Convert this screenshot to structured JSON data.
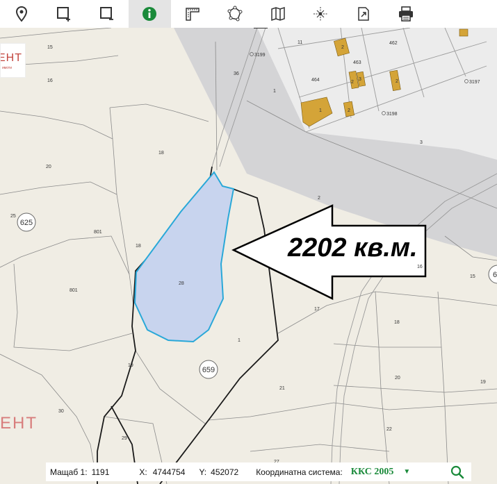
{
  "toolbar": {
    "tools": [
      {
        "name": "location-pin-icon",
        "active": false
      },
      {
        "name": "select-add-icon",
        "active": false
      },
      {
        "name": "select-remove-icon",
        "active": false
      },
      {
        "name": "info-icon",
        "active": true
      },
      {
        "name": "measure-icon",
        "active": false
      },
      {
        "name": "polygon-icon",
        "active": false
      },
      {
        "name": "map-icon",
        "active": false
      },
      {
        "name": "coordinates-icon",
        "active": false
      },
      {
        "name": "export-icon",
        "active": false
      },
      {
        "name": "print-icon",
        "active": false
      }
    ],
    "accent_color": "#1a8a3a"
  },
  "annotation": {
    "area_text": "2202 кв.м."
  },
  "logo": {
    "text": "ЕНТ",
    "subtext": "имоти"
  },
  "watermark": {
    "text": "ЕНТ"
  },
  "highlighted_parcel": {
    "number": "28",
    "fill_color": "#c8d4ee",
    "stroke_color": "#29a8d8"
  },
  "parcel_labels": {
    "l15": "15",
    "l16": "16",
    "l18a": "18",
    "l20a": "20",
    "l25": "25",
    "l801a": "801",
    "l801b": "801",
    "l18b": "18",
    "l28": "28",
    "l1a": "1",
    "l19a": "19",
    "l30": "30",
    "l29": "29",
    "l21": "21",
    "l27": "27",
    "l17": "17",
    "l2": "2",
    "l16b": "16",
    "l15b": "15",
    "l18c": "18",
    "l20b": "20",
    "l19b": "19",
    "l22": "22",
    "l36": "36",
    "l1b": "1",
    "l464": "464",
    "l463": "463",
    "l462": "462",
    "l11": "11",
    "l1c": "1",
    "l2a": "2",
    "l2b": "2",
    "l3a": "3",
    "l2c": "2",
    "l2d": "2",
    "l3": "3",
    "l3199": "3199",
    "l3198": "3198",
    "l3197": "3197"
  },
  "circle_labels": {
    "c625": "625",
    "c659": "659",
    "c6": "6"
  },
  "statusbar": {
    "scale_label": "Мащаб 1:",
    "scale_value": "1191",
    "x_label": "X:",
    "x_value": "4744754",
    "y_label": "Y:",
    "y_value": "452072",
    "cs_label": "Координатна система:",
    "cs_value": "ККС 2005",
    "cs_arrow": "▼"
  }
}
